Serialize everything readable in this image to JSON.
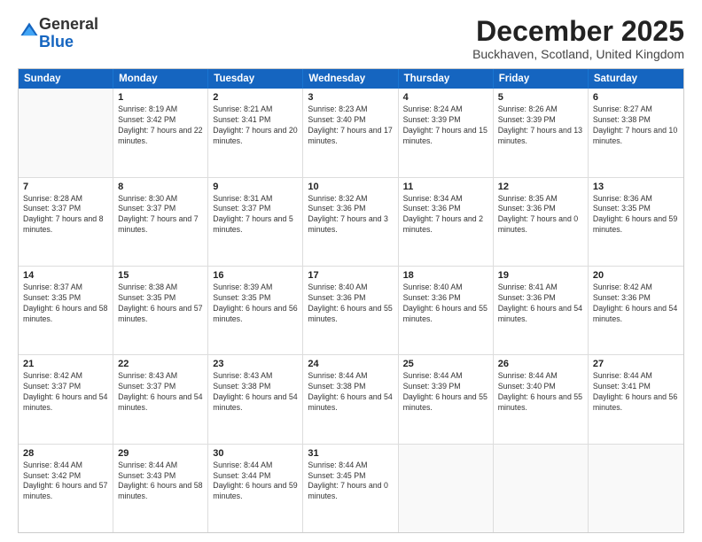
{
  "logo": {
    "general": "General",
    "blue": "Blue"
  },
  "title": "December 2025",
  "location": "Buckhaven, Scotland, United Kingdom",
  "days": [
    "Sunday",
    "Monday",
    "Tuesday",
    "Wednesday",
    "Thursday",
    "Friday",
    "Saturday"
  ],
  "weeks": [
    [
      {
        "day": "",
        "sunrise": "",
        "sunset": "",
        "daylight": ""
      },
      {
        "day": "1",
        "sunrise": "Sunrise: 8:19 AM",
        "sunset": "Sunset: 3:42 PM",
        "daylight": "Daylight: 7 hours and 22 minutes."
      },
      {
        "day": "2",
        "sunrise": "Sunrise: 8:21 AM",
        "sunset": "Sunset: 3:41 PM",
        "daylight": "Daylight: 7 hours and 20 minutes."
      },
      {
        "day": "3",
        "sunrise": "Sunrise: 8:23 AM",
        "sunset": "Sunset: 3:40 PM",
        "daylight": "Daylight: 7 hours and 17 minutes."
      },
      {
        "day": "4",
        "sunrise": "Sunrise: 8:24 AM",
        "sunset": "Sunset: 3:39 PM",
        "daylight": "Daylight: 7 hours and 15 minutes."
      },
      {
        "day": "5",
        "sunrise": "Sunrise: 8:26 AM",
        "sunset": "Sunset: 3:39 PM",
        "daylight": "Daylight: 7 hours and 13 minutes."
      },
      {
        "day": "6",
        "sunrise": "Sunrise: 8:27 AM",
        "sunset": "Sunset: 3:38 PM",
        "daylight": "Daylight: 7 hours and 10 minutes."
      }
    ],
    [
      {
        "day": "7",
        "sunrise": "Sunrise: 8:28 AM",
        "sunset": "Sunset: 3:37 PM",
        "daylight": "Daylight: 7 hours and 8 minutes."
      },
      {
        "day": "8",
        "sunrise": "Sunrise: 8:30 AM",
        "sunset": "Sunset: 3:37 PM",
        "daylight": "Daylight: 7 hours and 7 minutes."
      },
      {
        "day": "9",
        "sunrise": "Sunrise: 8:31 AM",
        "sunset": "Sunset: 3:37 PM",
        "daylight": "Daylight: 7 hours and 5 minutes."
      },
      {
        "day": "10",
        "sunrise": "Sunrise: 8:32 AM",
        "sunset": "Sunset: 3:36 PM",
        "daylight": "Daylight: 7 hours and 3 minutes."
      },
      {
        "day": "11",
        "sunrise": "Sunrise: 8:34 AM",
        "sunset": "Sunset: 3:36 PM",
        "daylight": "Daylight: 7 hours and 2 minutes."
      },
      {
        "day": "12",
        "sunrise": "Sunrise: 8:35 AM",
        "sunset": "Sunset: 3:36 PM",
        "daylight": "Daylight: 7 hours and 0 minutes."
      },
      {
        "day": "13",
        "sunrise": "Sunrise: 8:36 AM",
        "sunset": "Sunset: 3:35 PM",
        "daylight": "Daylight: 6 hours and 59 minutes."
      }
    ],
    [
      {
        "day": "14",
        "sunrise": "Sunrise: 8:37 AM",
        "sunset": "Sunset: 3:35 PM",
        "daylight": "Daylight: 6 hours and 58 minutes."
      },
      {
        "day": "15",
        "sunrise": "Sunrise: 8:38 AM",
        "sunset": "Sunset: 3:35 PM",
        "daylight": "Daylight: 6 hours and 57 minutes."
      },
      {
        "day": "16",
        "sunrise": "Sunrise: 8:39 AM",
        "sunset": "Sunset: 3:35 PM",
        "daylight": "Daylight: 6 hours and 56 minutes."
      },
      {
        "day": "17",
        "sunrise": "Sunrise: 8:40 AM",
        "sunset": "Sunset: 3:36 PM",
        "daylight": "Daylight: 6 hours and 55 minutes."
      },
      {
        "day": "18",
        "sunrise": "Sunrise: 8:40 AM",
        "sunset": "Sunset: 3:36 PM",
        "daylight": "Daylight: 6 hours and 55 minutes."
      },
      {
        "day": "19",
        "sunrise": "Sunrise: 8:41 AM",
        "sunset": "Sunset: 3:36 PM",
        "daylight": "Daylight: 6 hours and 54 minutes."
      },
      {
        "day": "20",
        "sunrise": "Sunrise: 8:42 AM",
        "sunset": "Sunset: 3:36 PM",
        "daylight": "Daylight: 6 hours and 54 minutes."
      }
    ],
    [
      {
        "day": "21",
        "sunrise": "Sunrise: 8:42 AM",
        "sunset": "Sunset: 3:37 PM",
        "daylight": "Daylight: 6 hours and 54 minutes."
      },
      {
        "day": "22",
        "sunrise": "Sunrise: 8:43 AM",
        "sunset": "Sunset: 3:37 PM",
        "daylight": "Daylight: 6 hours and 54 minutes."
      },
      {
        "day": "23",
        "sunrise": "Sunrise: 8:43 AM",
        "sunset": "Sunset: 3:38 PM",
        "daylight": "Daylight: 6 hours and 54 minutes."
      },
      {
        "day": "24",
        "sunrise": "Sunrise: 8:44 AM",
        "sunset": "Sunset: 3:38 PM",
        "daylight": "Daylight: 6 hours and 54 minutes."
      },
      {
        "day": "25",
        "sunrise": "Sunrise: 8:44 AM",
        "sunset": "Sunset: 3:39 PM",
        "daylight": "Daylight: 6 hours and 55 minutes."
      },
      {
        "day": "26",
        "sunrise": "Sunrise: 8:44 AM",
        "sunset": "Sunset: 3:40 PM",
        "daylight": "Daylight: 6 hours and 55 minutes."
      },
      {
        "day": "27",
        "sunrise": "Sunrise: 8:44 AM",
        "sunset": "Sunset: 3:41 PM",
        "daylight": "Daylight: 6 hours and 56 minutes."
      }
    ],
    [
      {
        "day": "28",
        "sunrise": "Sunrise: 8:44 AM",
        "sunset": "Sunset: 3:42 PM",
        "daylight": "Daylight: 6 hours and 57 minutes."
      },
      {
        "day": "29",
        "sunrise": "Sunrise: 8:44 AM",
        "sunset": "Sunset: 3:43 PM",
        "daylight": "Daylight: 6 hours and 58 minutes."
      },
      {
        "day": "30",
        "sunrise": "Sunrise: 8:44 AM",
        "sunset": "Sunset: 3:44 PM",
        "daylight": "Daylight: 6 hours and 59 minutes."
      },
      {
        "day": "31",
        "sunrise": "Sunrise: 8:44 AM",
        "sunset": "Sunset: 3:45 PM",
        "daylight": "Daylight: 7 hours and 0 minutes."
      },
      {
        "day": "",
        "sunrise": "",
        "sunset": "",
        "daylight": ""
      },
      {
        "day": "",
        "sunrise": "",
        "sunset": "",
        "daylight": ""
      },
      {
        "day": "",
        "sunrise": "",
        "sunset": "",
        "daylight": ""
      }
    ]
  ]
}
